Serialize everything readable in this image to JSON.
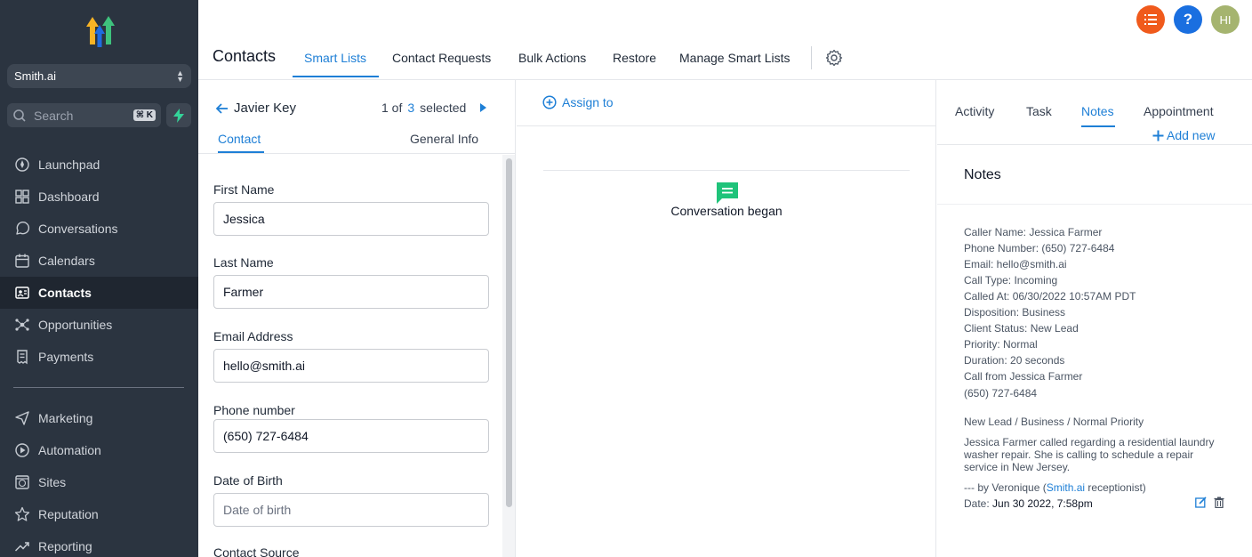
{
  "sidebar": {
    "account": "Smith.ai",
    "search": {
      "placeholder": "Search",
      "shortcut": "⌘ K"
    },
    "items": [
      {
        "label": "Launchpad",
        "icon": "rocket-icon"
      },
      {
        "label": "Dashboard",
        "icon": "grid-icon"
      },
      {
        "label": "Conversations",
        "icon": "chat-icon"
      },
      {
        "label": "Calendars",
        "icon": "calendar-icon"
      },
      {
        "label": "Contacts",
        "icon": "contact-card-icon",
        "active": true
      },
      {
        "label": "Opportunities",
        "icon": "network-icon"
      },
      {
        "label": "Payments",
        "icon": "receipt-icon"
      },
      {
        "label": "Marketing",
        "icon": "send-icon"
      },
      {
        "label": "Automation",
        "icon": "automation-icon"
      },
      {
        "label": "Sites",
        "icon": "globe-icon"
      },
      {
        "label": "Reputation",
        "icon": "star-icon"
      },
      {
        "label": "Reporting",
        "icon": "trend-icon"
      }
    ]
  },
  "header": {
    "avatar": "HI",
    "help": "?",
    "colors": {
      "list": "#f05a1c",
      "help": "#1a6fe0",
      "avatar": "#a5b46f"
    }
  },
  "topbar": {
    "title": "Contacts",
    "tabs": [
      "Smart Lists",
      "Contact Requests",
      "Bulk Actions",
      "Restore",
      "Manage Smart Lists"
    ]
  },
  "contact": {
    "name": "Javier Key",
    "counter": {
      "prefix": "1 of",
      "num": "3",
      "suffix": "selected"
    },
    "subtabs": [
      "Contact",
      "General Info"
    ],
    "fields": [
      {
        "label": "First Name",
        "value": "Jessica",
        "placeholder": ""
      },
      {
        "label": "Last Name",
        "value": "Farmer",
        "placeholder": ""
      },
      {
        "label": "Email Address",
        "value": "hello@smith.ai",
        "placeholder": ""
      },
      {
        "label": "Phone number",
        "value": "(650) 727-6484",
        "placeholder": ""
      },
      {
        "label": "Date of Birth",
        "value": "",
        "placeholder": "Date of birth"
      },
      {
        "label": "Contact Source",
        "value": "",
        "placeholder": ""
      }
    ]
  },
  "middle": {
    "assign": "Assign to",
    "conversation": "Conversation began"
  },
  "right": {
    "tabs": [
      "Activity",
      "Task",
      "Notes",
      "Appointment"
    ],
    "add_new": "Add new",
    "notes_title": "Notes",
    "note_lines": [
      "Caller Name: Jessica Farmer",
      "Phone Number: (650) 727-6484",
      "Email: hello@smith.ai",
      "Call Type: Incoming",
      "Called At: 06/30/2022 10:57AM PDT",
      "Disposition: Business",
      "Client Status: New Lead",
      "Priority: Normal",
      "Duration: 20 seconds",
      "Call from Jessica Farmer"
    ],
    "phone": "(650) 727-6484",
    "summary": "New Lead / Business / Normal Priority",
    "description": "Jessica Farmer called regarding a residential laundry washer repair. She is calling to schedule a repair service in New Jersey.",
    "by_prefix": "--- by Veronique (",
    "by_link": "Smith.ai",
    "by_suffix": " receptionist)",
    "date_label": "Date: ",
    "date_value": "Jun 30 2022, 7:58pm"
  },
  "accent": "#1e7fd6"
}
